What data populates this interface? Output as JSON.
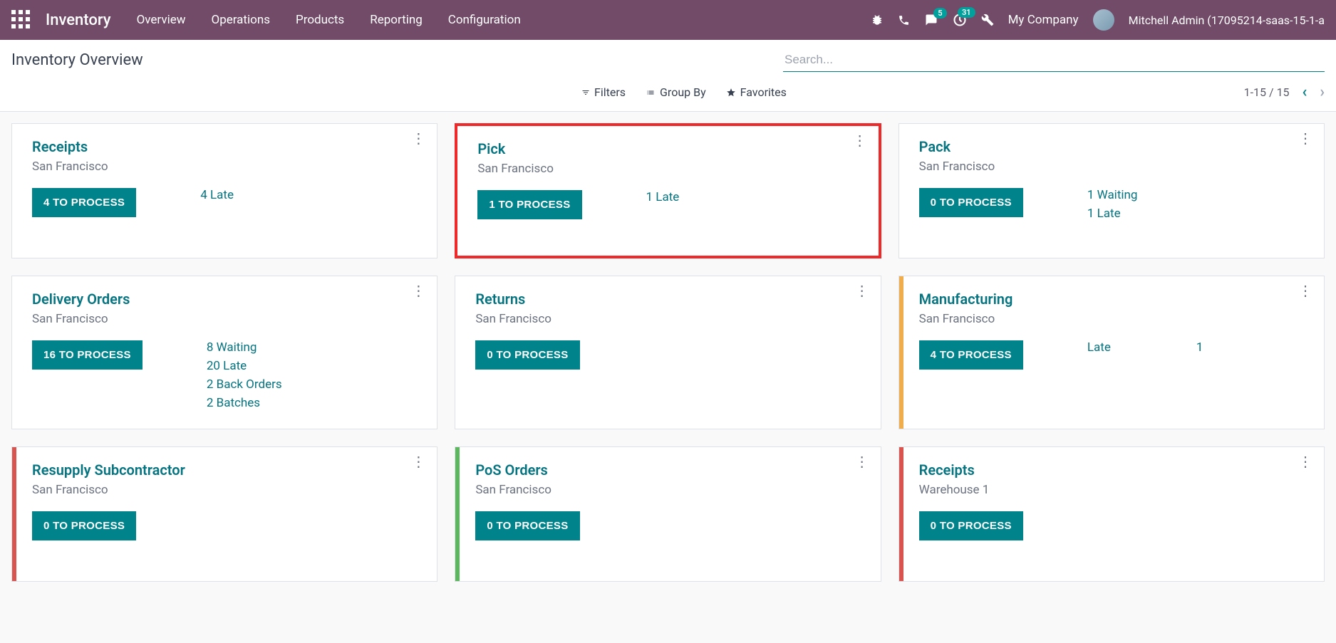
{
  "topbar": {
    "brand": "Inventory",
    "nav": [
      "Overview",
      "Operations",
      "Products",
      "Reporting",
      "Configuration"
    ],
    "messages_badge": "5",
    "activities_badge": "31",
    "company": "My Company",
    "user": "Mitchell Admin (17095214-saas-15-1-a"
  },
  "header": {
    "title": "Inventory Overview",
    "search_placeholder": "Search...",
    "filters": "Filters",
    "groupby": "Group By",
    "favorites": "Favorites",
    "pager": "1-15 / 15"
  },
  "cards": [
    {
      "title": "Receipts",
      "sub": "San Francisco",
      "btn": "4 TO PROCESS",
      "stats": [
        "4 Late"
      ],
      "stripe": null,
      "highlight": false
    },
    {
      "title": "Pick",
      "sub": "San Francisco",
      "btn": "1 TO PROCESS",
      "stats": [
        "1 Late"
      ],
      "stripe": null,
      "highlight": true
    },
    {
      "title": "Pack",
      "sub": "San Francisco",
      "btn": "0 TO PROCESS",
      "stats": [
        "1 Waiting",
        "1 Late"
      ],
      "stripe": null,
      "highlight": false
    },
    {
      "title": "Delivery Orders",
      "sub": "San Francisco",
      "btn": "16 TO PROCESS",
      "stats": [
        "8 Waiting",
        "20 Late",
        "2 Back Orders",
        "2 Batches"
      ],
      "stripe": null,
      "highlight": false
    },
    {
      "title": "Returns",
      "sub": "San Francisco",
      "btn": "0 TO PROCESS",
      "stats": [],
      "stripe": null,
      "highlight": false
    },
    {
      "title": "Manufacturing",
      "sub": "San Francisco",
      "btn": "4 TO PROCESS",
      "stats_row": {
        "label": "Late",
        "num": "1"
      },
      "stripe": "orange",
      "highlight": false
    },
    {
      "title": "Resupply Subcontractor",
      "sub": "San Francisco",
      "btn": "0 TO PROCESS",
      "stats": [],
      "stripe": "red",
      "highlight": false
    },
    {
      "title": "PoS Orders",
      "sub": "San Francisco",
      "btn": "0 TO PROCESS",
      "stats": [],
      "stripe": "green",
      "highlight": false
    },
    {
      "title": "Receipts",
      "sub": "Warehouse 1",
      "btn": "0 TO PROCESS",
      "stats": [],
      "stripe": "red",
      "highlight": false
    }
  ]
}
